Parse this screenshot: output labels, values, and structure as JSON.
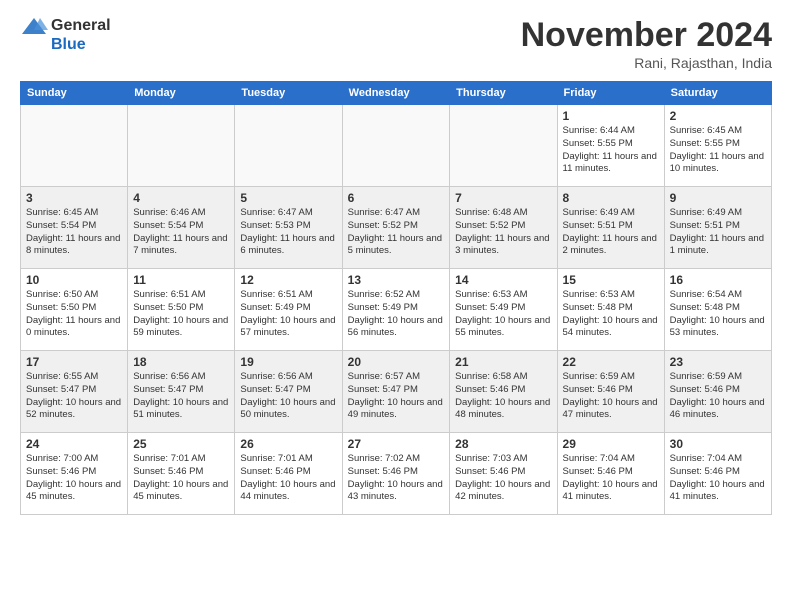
{
  "logo": {
    "line1": "General",
    "line2": "Blue"
  },
  "title": "November 2024",
  "location": "Rani, Rajasthan, India",
  "headers": [
    "Sunday",
    "Monday",
    "Tuesday",
    "Wednesday",
    "Thursday",
    "Friday",
    "Saturday"
  ],
  "weeks": [
    [
      {
        "day": "",
        "info": ""
      },
      {
        "day": "",
        "info": ""
      },
      {
        "day": "",
        "info": ""
      },
      {
        "day": "",
        "info": ""
      },
      {
        "day": "",
        "info": ""
      },
      {
        "day": "1",
        "info": "Sunrise: 6:44 AM\nSunset: 5:55 PM\nDaylight: 11 hours\nand 11 minutes."
      },
      {
        "day": "2",
        "info": "Sunrise: 6:45 AM\nSunset: 5:55 PM\nDaylight: 11 hours\nand 10 minutes."
      }
    ],
    [
      {
        "day": "3",
        "info": "Sunrise: 6:45 AM\nSunset: 5:54 PM\nDaylight: 11 hours\nand 8 minutes."
      },
      {
        "day": "4",
        "info": "Sunrise: 6:46 AM\nSunset: 5:54 PM\nDaylight: 11 hours\nand 7 minutes."
      },
      {
        "day": "5",
        "info": "Sunrise: 6:47 AM\nSunset: 5:53 PM\nDaylight: 11 hours\nand 6 minutes."
      },
      {
        "day": "6",
        "info": "Sunrise: 6:47 AM\nSunset: 5:52 PM\nDaylight: 11 hours\nand 5 minutes."
      },
      {
        "day": "7",
        "info": "Sunrise: 6:48 AM\nSunset: 5:52 PM\nDaylight: 11 hours\nand 3 minutes."
      },
      {
        "day": "8",
        "info": "Sunrise: 6:49 AM\nSunset: 5:51 PM\nDaylight: 11 hours\nand 2 minutes."
      },
      {
        "day": "9",
        "info": "Sunrise: 6:49 AM\nSunset: 5:51 PM\nDaylight: 11 hours\nand 1 minute."
      }
    ],
    [
      {
        "day": "10",
        "info": "Sunrise: 6:50 AM\nSunset: 5:50 PM\nDaylight: 11 hours\nand 0 minutes."
      },
      {
        "day": "11",
        "info": "Sunrise: 6:51 AM\nSunset: 5:50 PM\nDaylight: 10 hours\nand 59 minutes."
      },
      {
        "day": "12",
        "info": "Sunrise: 6:51 AM\nSunset: 5:49 PM\nDaylight: 10 hours\nand 57 minutes."
      },
      {
        "day": "13",
        "info": "Sunrise: 6:52 AM\nSunset: 5:49 PM\nDaylight: 10 hours\nand 56 minutes."
      },
      {
        "day": "14",
        "info": "Sunrise: 6:53 AM\nSunset: 5:49 PM\nDaylight: 10 hours\nand 55 minutes."
      },
      {
        "day": "15",
        "info": "Sunrise: 6:53 AM\nSunset: 5:48 PM\nDaylight: 10 hours\nand 54 minutes."
      },
      {
        "day": "16",
        "info": "Sunrise: 6:54 AM\nSunset: 5:48 PM\nDaylight: 10 hours\nand 53 minutes."
      }
    ],
    [
      {
        "day": "17",
        "info": "Sunrise: 6:55 AM\nSunset: 5:47 PM\nDaylight: 10 hours\nand 52 minutes."
      },
      {
        "day": "18",
        "info": "Sunrise: 6:56 AM\nSunset: 5:47 PM\nDaylight: 10 hours\nand 51 minutes."
      },
      {
        "day": "19",
        "info": "Sunrise: 6:56 AM\nSunset: 5:47 PM\nDaylight: 10 hours\nand 50 minutes."
      },
      {
        "day": "20",
        "info": "Sunrise: 6:57 AM\nSunset: 5:47 PM\nDaylight: 10 hours\nand 49 minutes."
      },
      {
        "day": "21",
        "info": "Sunrise: 6:58 AM\nSunset: 5:46 PM\nDaylight: 10 hours\nand 48 minutes."
      },
      {
        "day": "22",
        "info": "Sunrise: 6:59 AM\nSunset: 5:46 PM\nDaylight: 10 hours\nand 47 minutes."
      },
      {
        "day": "23",
        "info": "Sunrise: 6:59 AM\nSunset: 5:46 PM\nDaylight: 10 hours\nand 46 minutes."
      }
    ],
    [
      {
        "day": "24",
        "info": "Sunrise: 7:00 AM\nSunset: 5:46 PM\nDaylight: 10 hours\nand 45 minutes."
      },
      {
        "day": "25",
        "info": "Sunrise: 7:01 AM\nSunset: 5:46 PM\nDaylight: 10 hours\nand 45 minutes."
      },
      {
        "day": "26",
        "info": "Sunrise: 7:01 AM\nSunset: 5:46 PM\nDaylight: 10 hours\nand 44 minutes."
      },
      {
        "day": "27",
        "info": "Sunrise: 7:02 AM\nSunset: 5:46 PM\nDaylight: 10 hours\nand 43 minutes."
      },
      {
        "day": "28",
        "info": "Sunrise: 7:03 AM\nSunset: 5:46 PM\nDaylight: 10 hours\nand 42 minutes."
      },
      {
        "day": "29",
        "info": "Sunrise: 7:04 AM\nSunset: 5:46 PM\nDaylight: 10 hours\nand 41 minutes."
      },
      {
        "day": "30",
        "info": "Sunrise: 7:04 AM\nSunset: 5:46 PM\nDaylight: 10 hours\nand 41 minutes."
      }
    ]
  ]
}
